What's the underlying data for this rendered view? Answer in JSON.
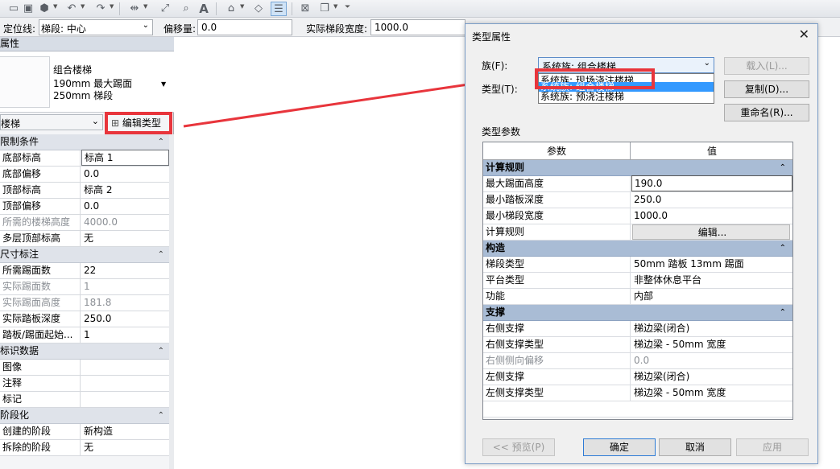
{
  "options_bar": {
    "location_line_label": "定位线:",
    "location_line_value": "梯段: 中心",
    "offset_label": "偏移量:",
    "offset_value": "0.0",
    "run_width_label": "实际梯段宽度:",
    "run_width_value": "1000.0"
  },
  "properties": {
    "title": "属性",
    "type_name": "组合楼梯",
    "type_line2": "190mm 最大踢面",
    "type_line3": "250mm 梯段",
    "category": "楼梯",
    "edit_type_label": "编辑类型",
    "groups": [
      {
        "label": "限制条件",
        "rows": [
          {
            "name": "底部标高",
            "value": "标高 1"
          },
          {
            "name": "底部偏移",
            "value": "0.0"
          },
          {
            "name": "顶部标高",
            "value": "标高 2"
          },
          {
            "name": "顶部偏移",
            "value": "0.0"
          },
          {
            "name": "所需的楼梯高度",
            "value": "4000.0"
          },
          {
            "name": "多层顶部标高",
            "value": "无"
          }
        ]
      },
      {
        "label": "尺寸标注",
        "rows": [
          {
            "name": "所需踢面数",
            "value": "22"
          },
          {
            "name": "实际踢面数",
            "value": "1"
          },
          {
            "name": "实际踢面高度",
            "value": "181.8"
          },
          {
            "name": "实际踏板深度",
            "value": "250.0"
          },
          {
            "name": "踏板/踢面起始...",
            "value": "1"
          }
        ]
      },
      {
        "label": "标识数据",
        "rows": [
          {
            "name": "图像",
            "value": ""
          },
          {
            "name": "注释",
            "value": ""
          },
          {
            "name": "标记",
            "value": ""
          }
        ]
      },
      {
        "label": "阶段化",
        "rows": [
          {
            "name": "创建的阶段",
            "value": "新构造"
          },
          {
            "name": "拆除的阶段",
            "value": "无"
          }
        ]
      }
    ]
  },
  "dialog": {
    "title": "类型属性",
    "family_label": "族(F):",
    "family_value": "系统族: 组合楼梯",
    "type_label": "类型(T):",
    "family_options": [
      "系统族: 现场浇注楼梯",
      "系统族: 组合楼梯",
      "系统族: 预浇注楼梯"
    ],
    "load_button": "载入(L)...",
    "duplicate_button": "复制(D)...",
    "rename_button": "重命名(R)...",
    "type_params_label": "类型参数",
    "col_param": "参数",
    "col_value": "值",
    "groups": [
      {
        "label": "计算规则",
        "rows": [
          {
            "name": "最大踢面高度",
            "value": "190.0"
          },
          {
            "name": "最小踏板深度",
            "value": "250.0"
          },
          {
            "name": "最小梯段宽度",
            "value": "1000.0"
          },
          {
            "name": "计算规则",
            "value": "编辑..."
          }
        ]
      },
      {
        "label": "构造",
        "rows": [
          {
            "name": "梯段类型",
            "value": "50mm 踏板 13mm 踢面"
          },
          {
            "name": "平台类型",
            "value": "非整体休息平台"
          },
          {
            "name": "功能",
            "value": "内部"
          }
        ]
      },
      {
        "label": "支撑",
        "rows": [
          {
            "name": "右侧支撑",
            "value": "梯边梁(闭合)"
          },
          {
            "name": "右侧支撑类型",
            "value": "梯边梁 - 50mm 宽度"
          },
          {
            "name": "右侧侧向偏移",
            "value": "0.0"
          },
          {
            "name": "左侧支撑",
            "value": "梯边梁(闭合)"
          },
          {
            "name": "左侧支撑类型",
            "value": "梯边梁 - 50mm 宽度"
          }
        ]
      }
    ],
    "preview_button": "<< 预览(P)",
    "ok_button": "确定",
    "cancel_button": "取消",
    "apply_button": "应用"
  },
  "colors": {
    "highlight_red": "#e8353c",
    "dialog_group_header": "#a9bcd5",
    "selection_blue": "#3399ff"
  }
}
